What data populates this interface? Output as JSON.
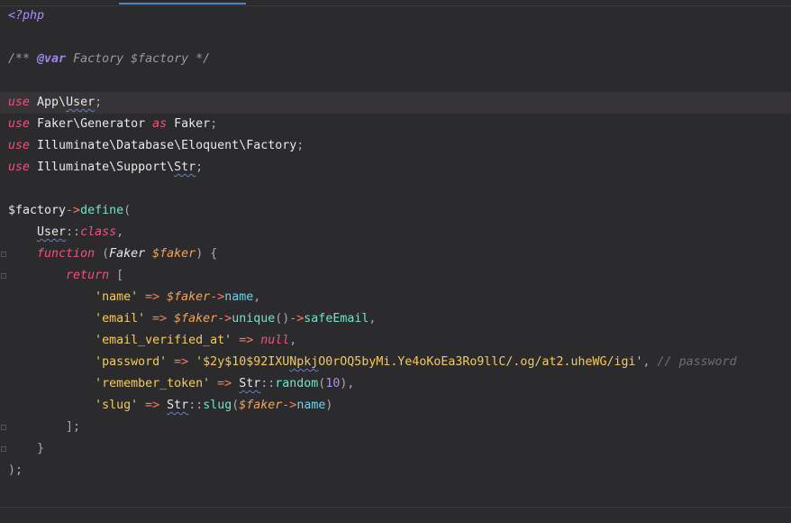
{
  "editor": {
    "lines": [
      {
        "name": "line-php-open",
        "tokens": [
          {
            "t": "<?php",
            "c": "tag"
          }
        ]
      },
      {
        "name": "line-blank-1",
        "tokens": []
      },
      {
        "name": "line-docblock",
        "tokens": [
          {
            "t": "/** ",
            "c": "doc"
          },
          {
            "t": "@var",
            "c": "docvar"
          },
          {
            "t": " Factory $factory */",
            "c": "doc"
          }
        ]
      },
      {
        "name": "line-blank-2",
        "tokens": []
      },
      {
        "name": "line-use-user",
        "current": true,
        "tokens": [
          {
            "t": "use",
            "c": "kw"
          },
          {
            "t": " App\\",
            "c": "ns"
          },
          {
            "t": "User",
            "c": "ns uline"
          },
          {
            "t": ";",
            "c": "punc"
          }
        ]
      },
      {
        "name": "line-use-faker",
        "tokens": [
          {
            "t": "use",
            "c": "kw"
          },
          {
            "t": " Faker\\Generator ",
            "c": "ns"
          },
          {
            "t": "as",
            "c": "kw"
          },
          {
            "t": " Faker",
            "c": "ns"
          },
          {
            "t": ";",
            "c": "punc"
          }
        ]
      },
      {
        "name": "line-use-factory",
        "tokens": [
          {
            "t": "use",
            "c": "kw"
          },
          {
            "t": " Illuminate\\Database\\Eloquent\\Factory",
            "c": "ns"
          },
          {
            "t": ";",
            "c": "punc"
          }
        ]
      },
      {
        "name": "line-use-str",
        "tokens": [
          {
            "t": "use",
            "c": "kw"
          },
          {
            "t": " Illuminate\\Support\\",
            "c": "ns"
          },
          {
            "t": "Str",
            "c": "ns uline"
          },
          {
            "t": ";",
            "c": "punc"
          }
        ]
      },
      {
        "name": "line-blank-3",
        "tokens": []
      },
      {
        "name": "line-factory-define",
        "tokens": [
          {
            "t": "$factory",
            "c": "varp"
          },
          {
            "t": "->",
            "c": "arrow"
          },
          {
            "t": "define",
            "c": "fn"
          },
          {
            "t": "(",
            "c": "punc"
          }
        ]
      },
      {
        "name": "line-user-class",
        "tokens": [
          {
            "t": "    ",
            "c": ""
          },
          {
            "t": "User",
            "c": "cls uline"
          },
          {
            "t": "::",
            "c": "punc"
          },
          {
            "t": "class",
            "c": "pinkit"
          },
          {
            "t": ",",
            "c": "punc"
          }
        ]
      },
      {
        "name": "line-function",
        "tokens": [
          {
            "t": "    ",
            "c": ""
          },
          {
            "t": "function",
            "c": "kw"
          },
          {
            "t": " (",
            "c": "punc"
          },
          {
            "t": "Faker",
            "c": "cls italic"
          },
          {
            "t": " ",
            "c": ""
          },
          {
            "t": "$faker",
            "c": "var"
          },
          {
            "t": ") {",
            "c": "punc"
          }
        ]
      },
      {
        "name": "line-return",
        "tokens": [
          {
            "t": "        ",
            "c": ""
          },
          {
            "t": "return",
            "c": "kw"
          },
          {
            "t": " [",
            "c": "punc"
          }
        ]
      },
      {
        "name": "line-name",
        "tokens": [
          {
            "t": "            ",
            "c": ""
          },
          {
            "t": "'name'",
            "c": "str"
          },
          {
            "t": " => ",
            "c": "arrow"
          },
          {
            "t": "$faker",
            "c": "var"
          },
          {
            "t": "->",
            "c": "arrow"
          },
          {
            "t": "name",
            "c": "prop"
          },
          {
            "t": ",",
            "c": "punc"
          }
        ]
      },
      {
        "name": "line-email",
        "tokens": [
          {
            "t": "            ",
            "c": ""
          },
          {
            "t": "'email'",
            "c": "str"
          },
          {
            "t": " => ",
            "c": "arrow"
          },
          {
            "t": "$faker",
            "c": "var"
          },
          {
            "t": "->",
            "c": "arrow"
          },
          {
            "t": "unique",
            "c": "fn"
          },
          {
            "t": "()",
            "c": "punc"
          },
          {
            "t": "->",
            "c": "arrow"
          },
          {
            "t": "safeEmail",
            "c": "fn"
          },
          {
            "t": ",",
            "c": "punc"
          }
        ]
      },
      {
        "name": "line-email-verified",
        "tokens": [
          {
            "t": "            ",
            "c": ""
          },
          {
            "t": "'email_verified_at'",
            "c": "str"
          },
          {
            "t": " => ",
            "c": "arrow"
          },
          {
            "t": "null",
            "c": "pinkit"
          },
          {
            "t": ",",
            "c": "punc"
          }
        ]
      },
      {
        "name": "line-password",
        "tokens": [
          {
            "t": "            ",
            "c": ""
          },
          {
            "t": "'password'",
            "c": "str"
          },
          {
            "t": " => ",
            "c": "arrow"
          },
          {
            "t": "'$2y$10$92IXU",
            "c": "str"
          },
          {
            "t": "Npkj",
            "c": "str uline"
          },
          {
            "t": "O0rOQ5byMi.Ye4oKoEa3Ro9llC/.og/at2.uheWG/igi'",
            "c": "str"
          },
          {
            "t": ", ",
            "c": "punc"
          },
          {
            "t": "// password",
            "c": "cmt"
          }
        ]
      },
      {
        "name": "line-remember-token",
        "tokens": [
          {
            "t": "            ",
            "c": ""
          },
          {
            "t": "'remember_token'",
            "c": "str"
          },
          {
            "t": " => ",
            "c": "arrow"
          },
          {
            "t": "Str",
            "c": "cls uline"
          },
          {
            "t": "::",
            "c": "punc"
          },
          {
            "t": "random",
            "c": "fn"
          },
          {
            "t": "(",
            "c": "punc"
          },
          {
            "t": "10",
            "c": "num"
          },
          {
            "t": "),",
            "c": "punc"
          }
        ]
      },
      {
        "name": "line-slug",
        "tokens": [
          {
            "t": "            ",
            "c": ""
          },
          {
            "t": "'slug'",
            "c": "str"
          },
          {
            "t": " => ",
            "c": "arrow"
          },
          {
            "t": "Str",
            "c": "cls uline"
          },
          {
            "t": "::",
            "c": "punc"
          },
          {
            "t": "slug",
            "c": "fn"
          },
          {
            "t": "(",
            "c": "punc"
          },
          {
            "t": "$faker",
            "c": "var"
          },
          {
            "t": "->",
            "c": "arrow"
          },
          {
            "t": "name",
            "c": "prop"
          },
          {
            "t": ")",
            "c": "punc"
          }
        ]
      },
      {
        "name": "line-close-array",
        "tokens": [
          {
            "t": "        ",
            "c": ""
          },
          {
            "t": "];",
            "c": "punc"
          }
        ]
      },
      {
        "name": "line-close-function",
        "tokens": [
          {
            "t": "    ",
            "c": ""
          },
          {
            "t": "}",
            "c": "punc"
          }
        ]
      },
      {
        "name": "line-close-define",
        "tokens": [
          {
            "t": ");",
            "c": "punc"
          }
        ]
      }
    ],
    "folds": [
      "line-function",
      "line-return",
      "line-close-array",
      "line-close-function"
    ]
  },
  "colors": {
    "background": "#2b2b2e",
    "current_line": "#363437",
    "keyword": "#f0527b",
    "string": "#f5c95c",
    "variable": "#f0a35c",
    "function": "#70e3c9",
    "comment": "#6f6f73",
    "tab_indicator": "#4a88c7"
  }
}
